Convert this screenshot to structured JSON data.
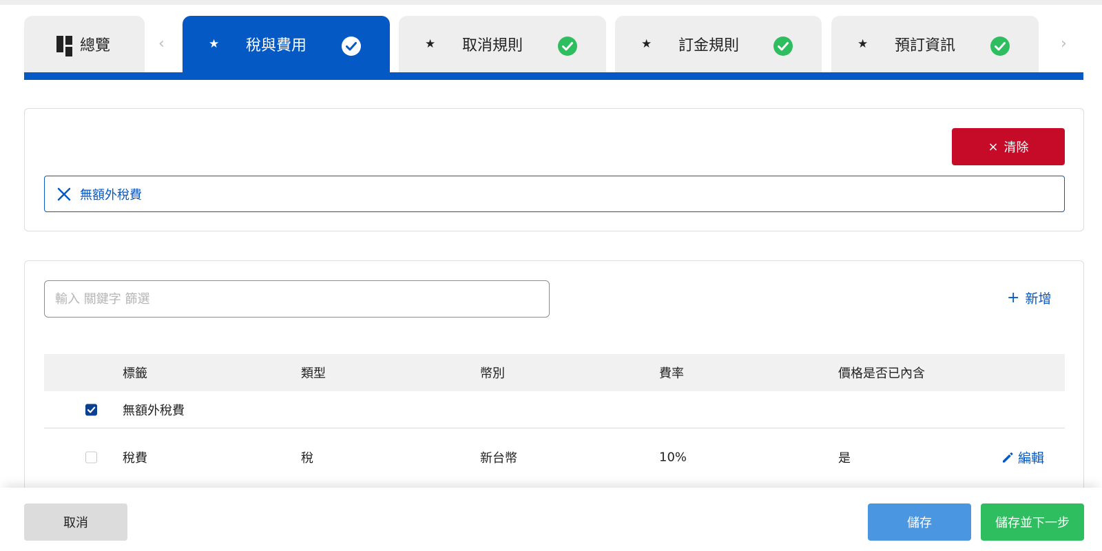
{
  "tabs": {
    "overview_label": "總覽",
    "items": [
      {
        "label": "稅與費用",
        "active": true,
        "completed": true
      },
      {
        "label": "取消規則",
        "active": false,
        "completed": true
      },
      {
        "label": "訂金規則",
        "active": false,
        "completed": true
      },
      {
        "label": "預訂資訊",
        "active": false,
        "completed": true
      }
    ],
    "prev_arrow": "‹",
    "next_arrow": "›",
    "star_glyph": "★"
  },
  "selection_panel": {
    "clear_label": "清除",
    "clear_glyph": "×",
    "selected_tag": "無額外稅費"
  },
  "list_panel": {
    "filter_placeholder": "輸入 關鍵字 篩選",
    "filter_value": "",
    "add_glyph": "+",
    "add_label": "新增",
    "columns": [
      "標籤",
      "類型",
      "幣別",
      "費率",
      "價格是否已內含"
    ],
    "rows": [
      {
        "checked": true,
        "label": "無額外稅費",
        "type": "",
        "currency": "",
        "rate": "",
        "included": ""
      },
      {
        "checked": false,
        "label": "稅費",
        "type": "稅",
        "currency": "新台幣",
        "rate": "10%",
        "included": "是",
        "edit_label": "編輯"
      }
    ]
  },
  "footer": {
    "cancel_label": "取消",
    "save_label": "儲存",
    "save_next_label": "儲存並下一步"
  },
  "colors": {
    "primary": "#0459c4",
    "danger": "#c60b28",
    "success": "#2fbe5f",
    "save": "#4a96e0"
  }
}
